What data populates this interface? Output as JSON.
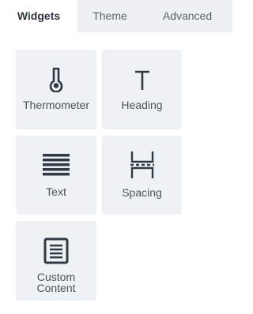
{
  "tabs": [
    {
      "label": "Widgets",
      "active": true
    },
    {
      "label": "Theme",
      "active": false
    },
    {
      "label": "Advanced",
      "active": false
    }
  ],
  "widgets": [
    {
      "label": "Thermometer",
      "icon": "thermometer-icon"
    },
    {
      "label": "Heading",
      "icon": "heading-icon"
    },
    {
      "label": "Text",
      "icon": "text-lines-icon"
    },
    {
      "label": "Spacing",
      "icon": "spacing-icon"
    },
    {
      "label_line1": "Custom",
      "label_line2": "Content",
      "icon": "custom-content-icon"
    }
  ],
  "colors": {
    "tab_bar": "#eef1f4",
    "card_bg": "#eef2f5",
    "icon": "#2f3a45"
  }
}
